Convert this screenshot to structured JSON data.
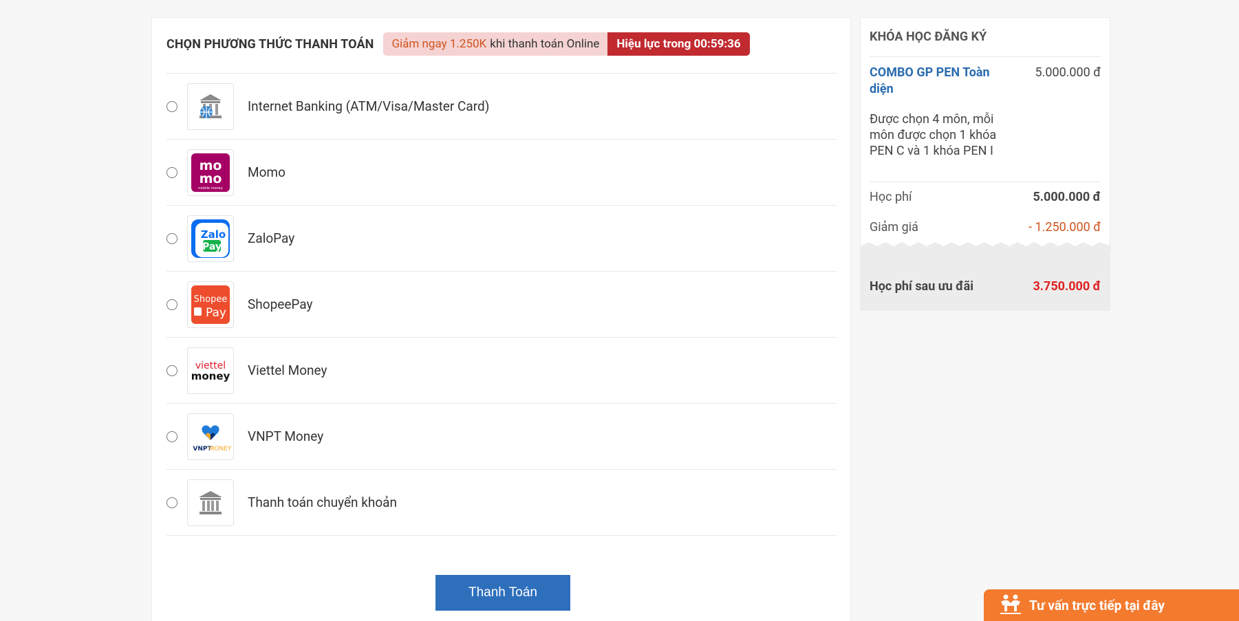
{
  "payment": {
    "title": "CHỌN PHƯƠNG THỨC THANH TOÁN",
    "promo_amount": "Giảm ngay 1.250K",
    "promo_text": "khi thanh toán Online",
    "countdown": "Hiệu lực trong 00:59:36",
    "methods": [
      {
        "label": "Internet Banking (ATM/Visa/Master Card)",
        "icon": "bank-globe-icon"
      },
      {
        "label": "Momo",
        "icon": "momo-logo"
      },
      {
        "label": "ZaloPay",
        "icon": "zalopay-logo"
      },
      {
        "label": "ShopeePay",
        "icon": "shopeepay-logo"
      },
      {
        "label": "Viettel Money",
        "icon": "viettel-money-logo"
      },
      {
        "label": "VNPT Money",
        "icon": "vnpt-money-logo"
      },
      {
        "label": "Thanh toán chuyển khoản",
        "icon": "bank-icon"
      }
    ],
    "submit_label": "Thanh Toán"
  },
  "logos": {
    "momo_top": "mo",
    "momo_bottom": "mo",
    "momo_sub": "mobile money",
    "zalo_top": "Zalo",
    "zalo_bottom": "Pay",
    "shopee_top": "Shopee",
    "shopee_bottom": "Pay",
    "viettel_top": "viettel",
    "viettel_bottom": "money",
    "vnpt_a": "VNPT",
    "vnpt_b": "MONEY"
  },
  "summary": {
    "title": "KHÓA HỌC ĐĂNG KÝ",
    "course_name": "COMBO GP PEN Toàn diện",
    "course_price": "5.000.000 đ",
    "course_desc": "Được chọn 4 môn, mỗi môn được chọn 1 khóa PEN C và 1 khóa PEN I",
    "fee_label": "Học phí",
    "fee_value": "5.000.000 đ",
    "discount_label": "Giảm giá",
    "discount_value": "- 1.250.000 đ",
    "total_label": "Học phí sau ưu đãi",
    "total_value": "3.750.000 đ"
  },
  "chat": {
    "label": "Tư vấn trực tiếp tại đây",
    "icon": "people-icon"
  },
  "colors": {
    "accent": "#2e6fbc",
    "promo_bg": "#f5d3d3",
    "countdown_bg": "#c12a2f",
    "discount": "#d0551f",
    "total": "#e02020",
    "chat": "#f47a2e"
  }
}
